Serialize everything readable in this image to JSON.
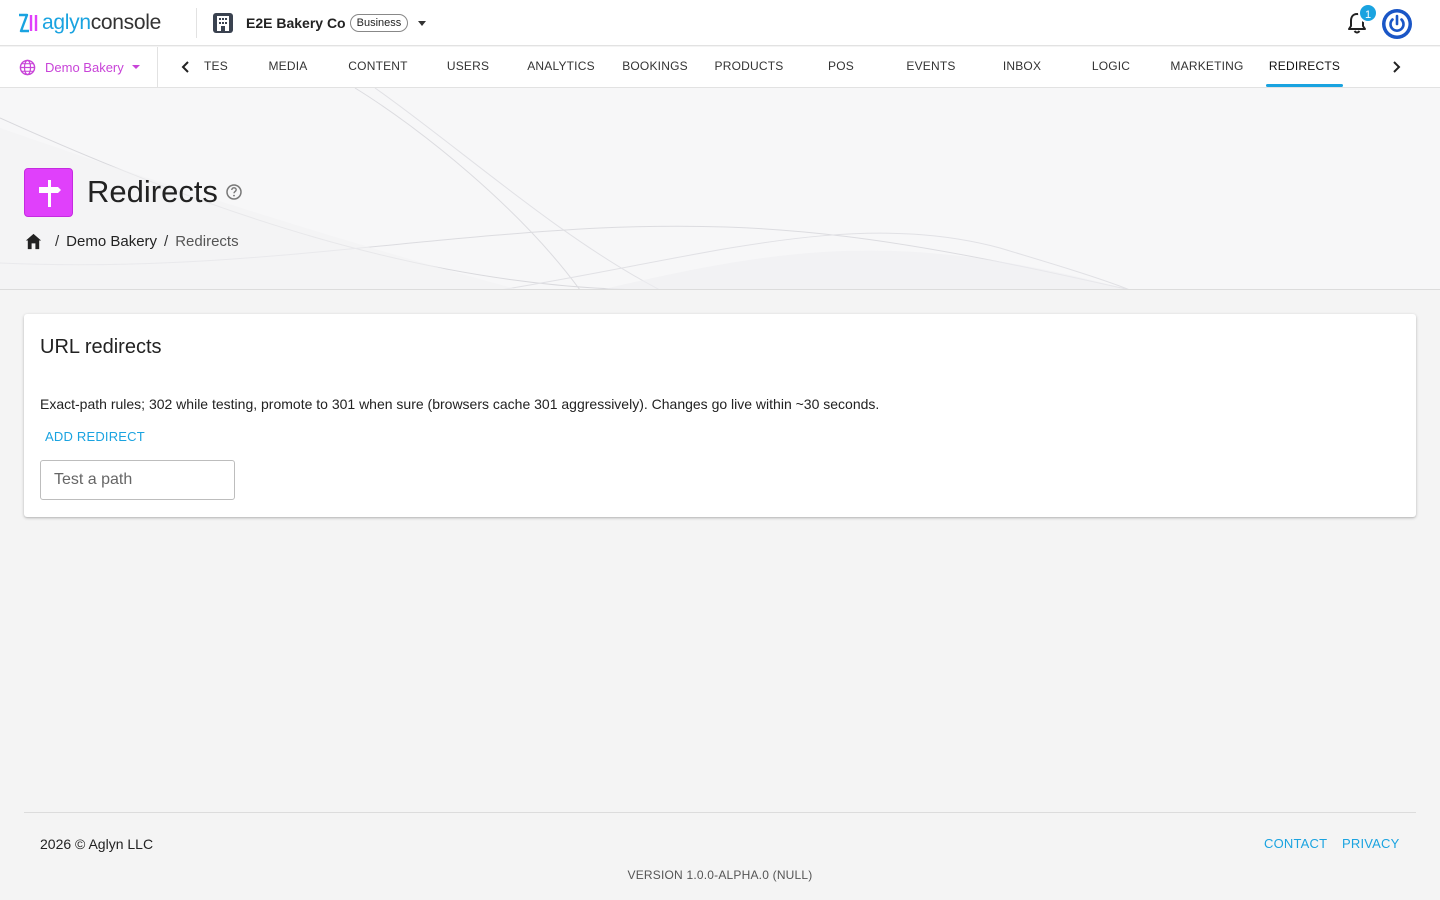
{
  "app": {
    "logo_brand": "aglyn",
    "logo_product": "console"
  },
  "org": {
    "name": "E2E Bakery Co",
    "plan_badge": "Business"
  },
  "notifications": {
    "count": "1"
  },
  "site_selector": {
    "label": "Demo Bakery"
  },
  "nav": {
    "tabs": [
      {
        "label": "TES"
      },
      {
        "label": "MEDIA"
      },
      {
        "label": "CONTENT"
      },
      {
        "label": "USERS"
      },
      {
        "label": "ANALYTICS"
      },
      {
        "label": "BOOKINGS"
      },
      {
        "label": "PRODUCTS"
      },
      {
        "label": "POS"
      },
      {
        "label": "EVENTS"
      },
      {
        "label": "INBOX"
      },
      {
        "label": "LOGIC"
      },
      {
        "label": "MARKETING"
      },
      {
        "label": "REDIRECTS"
      }
    ],
    "active_tab": "REDIRECTS"
  },
  "page": {
    "title": "Redirects",
    "breadcrumb": [
      "Demo Bakery",
      "Redirects"
    ]
  },
  "card": {
    "title": "URL redirects",
    "description": "Exact-path rules; 302 while testing, promote to 301 when sure (browsers cache 301 aggressively). Changes go live within ~30 seconds.",
    "add_button": "ADD REDIRECT",
    "test_path_placeholder": "Test a path"
  },
  "footer": {
    "copyright": "2026 © Aglyn LLC",
    "contact": "CONTACT",
    "privacy": "PRIVACY",
    "version": "VERSION 1.0.0-ALPHA.0 (NULL)"
  },
  "colors": {
    "accent_blue": "#1aa3e0",
    "accent_magenta": "#e040fb",
    "site_label": "#c844d8"
  }
}
